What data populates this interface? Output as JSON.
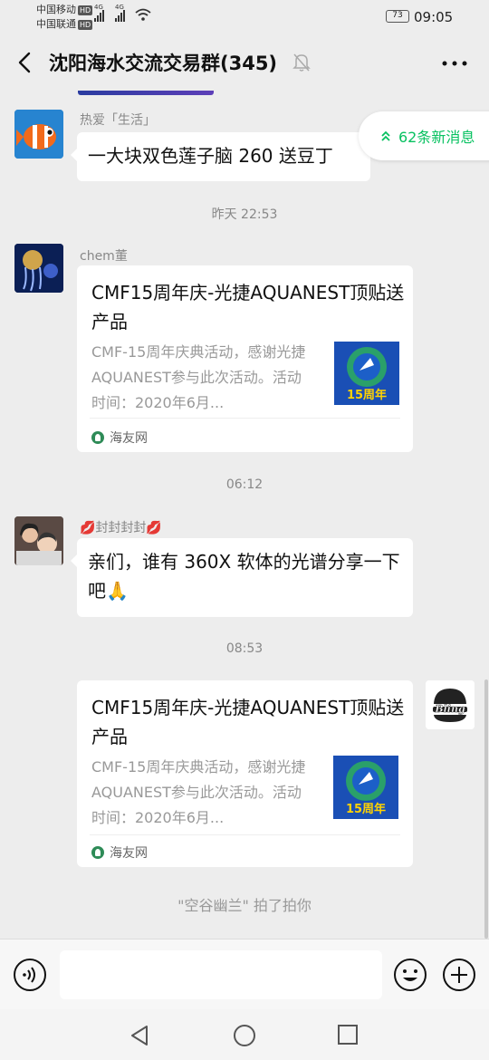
{
  "status_bar": {
    "carrier1": "中国移动",
    "carrier2": "中国联通",
    "hd_badge": "HD",
    "net1": "4G",
    "net2": "4G",
    "battery": "73",
    "time": "09:05"
  },
  "header": {
    "title": "沈阳海水交流交易群(345)",
    "icons": [
      "back-icon",
      "mute-icon",
      "more-icon"
    ]
  },
  "new_messages": {
    "label": "62条新消息",
    "icon": "double-chevron-up-icon",
    "color": "#07c160"
  },
  "messages": [
    {
      "sender": "热爱「生活」",
      "text": "一大块双色莲子脑 260 送豆丁"
    },
    {
      "timestamp": "昨天 22:53"
    },
    {
      "sender": "chem董",
      "card": {
        "title": "CMF15周年庆-光捷AQUANEST顶贴送产品",
        "desc": "CMF-15周年庆典活动，感谢光捷AQUANEST参与此次活动。活动时间：2020年6月...",
        "thumb_label": "15周年",
        "source": "海友网"
      }
    },
    {
      "timestamp": "06:12"
    },
    {
      "sender": "💋封封封封💋",
      "text": "亲们，谁有 360X 软体的光谱分享一下吧🙏"
    },
    {
      "timestamp": "08:53"
    },
    {
      "self": true,
      "card": {
        "title": "CMF15周年庆-光捷AQUANEST顶贴送产品",
        "desc": "CMF-15周年庆典活动，感谢光捷AQUANEST参与此次活动。活动时间：2020年6月...",
        "thumb_label": "15周年",
        "source": "海友网"
      },
      "avatar_text": "Bling"
    }
  ],
  "pat_note": "\"空谷幽兰\" 拍了拍你",
  "input_bar": {
    "value": "",
    "icons": [
      "voice-icon",
      "emoji-icon",
      "plus-icon"
    ]
  },
  "nav_bar": {
    "icons": [
      "nav-back-icon",
      "nav-home-icon",
      "nav-recent-icon"
    ]
  },
  "colors": {
    "background": "#ededed",
    "bubble": "#ffffff",
    "accent": "#07c160"
  }
}
